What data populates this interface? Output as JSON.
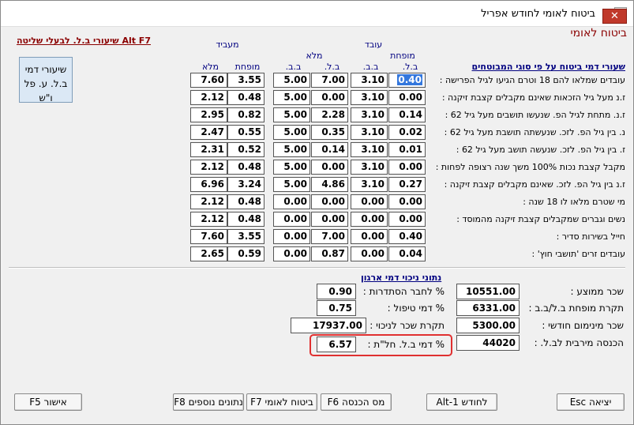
{
  "window": {
    "title": "ביטוח לאומי לחודש אפריל",
    "close": "✕"
  },
  "header": {
    "section_title": "ביטוח לאומי",
    "alt_f7": "שיעורי ב.ל. לבעלי שליטה Alt F7",
    "rates_box": [
      "שיעורי דמי",
      "ב.ל. ע. פל",
      "ו\"ש"
    ]
  },
  "columns": {
    "group_employee": "עובד",
    "group_employer": "מעביד",
    "sub_reduced": "מופחת",
    "sub_full": "מלא",
    "bl": "ב.ל.",
    "bb": "ב.ב.",
    "employer_reduced": "מופחת",
    "employer_full": "מלא",
    "rows_title": "שעורי דמי ביטוח  על פי סוגי המבוטחים"
  },
  "rows": [
    {
      "label": "עובדים שמלאו להם 18 וטרם הגיעו לגיל הפרישה :",
      "bl_r": "0.40",
      "bb_r": "3.10",
      "bl_f": "7.00",
      "bb_f": "5.00",
      "er_r": "3.55",
      "er_f": "7.60"
    },
    {
      "label": "ז.נ מעל גיל הזכאות שאינם מקבלים קצבת זיקנה :",
      "bl_r": "0.00",
      "bb_r": "3.10",
      "bl_f": "0.00",
      "bb_f": "5.00",
      "er_r": "0.48",
      "er_f": "2.12"
    },
    {
      "label": "ז.נ. מתחת לגיל הפ. שנעשו תושבים מעל גיל 62 :",
      "bl_r": "0.14",
      "bb_r": "3.10",
      "bl_f": "2.28",
      "bb_f": "5.00",
      "er_r": "0.82",
      "er_f": "2.95"
    },
    {
      "label": "נ. בין גיל הפ. לזכ. שנעשתה תושבת מעל גיל 62 :",
      "bl_r": "0.02",
      "bb_r": "3.10",
      "bl_f": "0.35",
      "bb_f": "5.00",
      "er_r": "0.55",
      "er_f": "2.47"
    },
    {
      "label": "ז. בין גיל הפ. לזכ. שנעשה תושב מעל גיל 62 :",
      "bl_r": "0.01",
      "bb_r": "3.10",
      "bl_f": "0.14",
      "bb_f": "5.00",
      "er_r": "0.52",
      "er_f": "2.31"
    },
    {
      "label": "מקבל קצבת נכות 100% משך שנה רצופה לפחות :",
      "bl_r": "0.00",
      "bb_r": "3.10",
      "bl_f": "0.00",
      "bb_f": "5.00",
      "er_r": "0.48",
      "er_f": "2.12"
    },
    {
      "label": "ז.נ בין גיל הפ. לזכ. שאינם מקבלים קצבת זיקנה :",
      "bl_r": "0.27",
      "bb_r": "3.10",
      "bl_f": "4.86",
      "bb_f": "5.00",
      "er_r": "3.24",
      "er_f": "6.96"
    },
    {
      "label": "מי שטרם מלאו לו 18 שנה :",
      "bl_r": "0.00",
      "bb_r": "0.00",
      "bl_f": "0.00",
      "bb_f": "0.00",
      "er_r": "0.48",
      "er_f": "2.12"
    },
    {
      "label": "נשים וגברים שמקבלים קצבת זיקנה מהמוסד :",
      "bl_r": "0.00",
      "bb_r": "0.00",
      "bl_f": "0.00",
      "bb_f": "0.00",
      "er_r": "0.48",
      "er_f": "2.12"
    },
    {
      "label": "חייל בשירות סדיר :",
      "bl_r": "0.40",
      "bb_r": "0.00",
      "bl_f": "7.00",
      "bb_f": "0.00",
      "er_r": "3.55",
      "er_f": "7.60"
    },
    {
      "label": "עובדים זרים 'תושבי חוץ' :",
      "bl_r": "0.04",
      "bb_r": "0.00",
      "bl_f": "0.87",
      "bb_f": "0.00",
      "er_r": "0.59",
      "er_f": "2.65"
    }
  ],
  "bottom": {
    "org_title": "נתוני ניכוי דמי ארגון",
    "avg_wage_label": "שכר ממוצע :",
    "avg_wage": "10551.00",
    "reduced_ceiling_label": "תקרת מופחת ב.ל/ב.ב :",
    "reduced_ceiling": "6331.00",
    "min_wage_label": "שכר מינימום חודשי :",
    "min_wage": "5300.00",
    "max_income_label": "הכנסה מירבית לב.ל. :",
    "max_income": "44020",
    "union_label": "% לחבר הסתדרות :",
    "union": "0.90",
    "handling_label": "% דמי טיפול :",
    "handling": "0.75",
    "deduction_ceiling_label": "תקרת שכר לניכוי :",
    "deduction_ceiling": "17937.00",
    "abroad_label": "% דמי ב.ל. חל\"ת :",
    "abroad": "6.57"
  },
  "buttons": {
    "confirm": "אישור F5",
    "extra_data": "נתונים נוספים F8",
    "social_security": "ביטוח לאומי F7",
    "income_tax": "מס הכנסה F6",
    "to_month": "לחודש Alt-1",
    "exit": "יציאה Esc"
  }
}
